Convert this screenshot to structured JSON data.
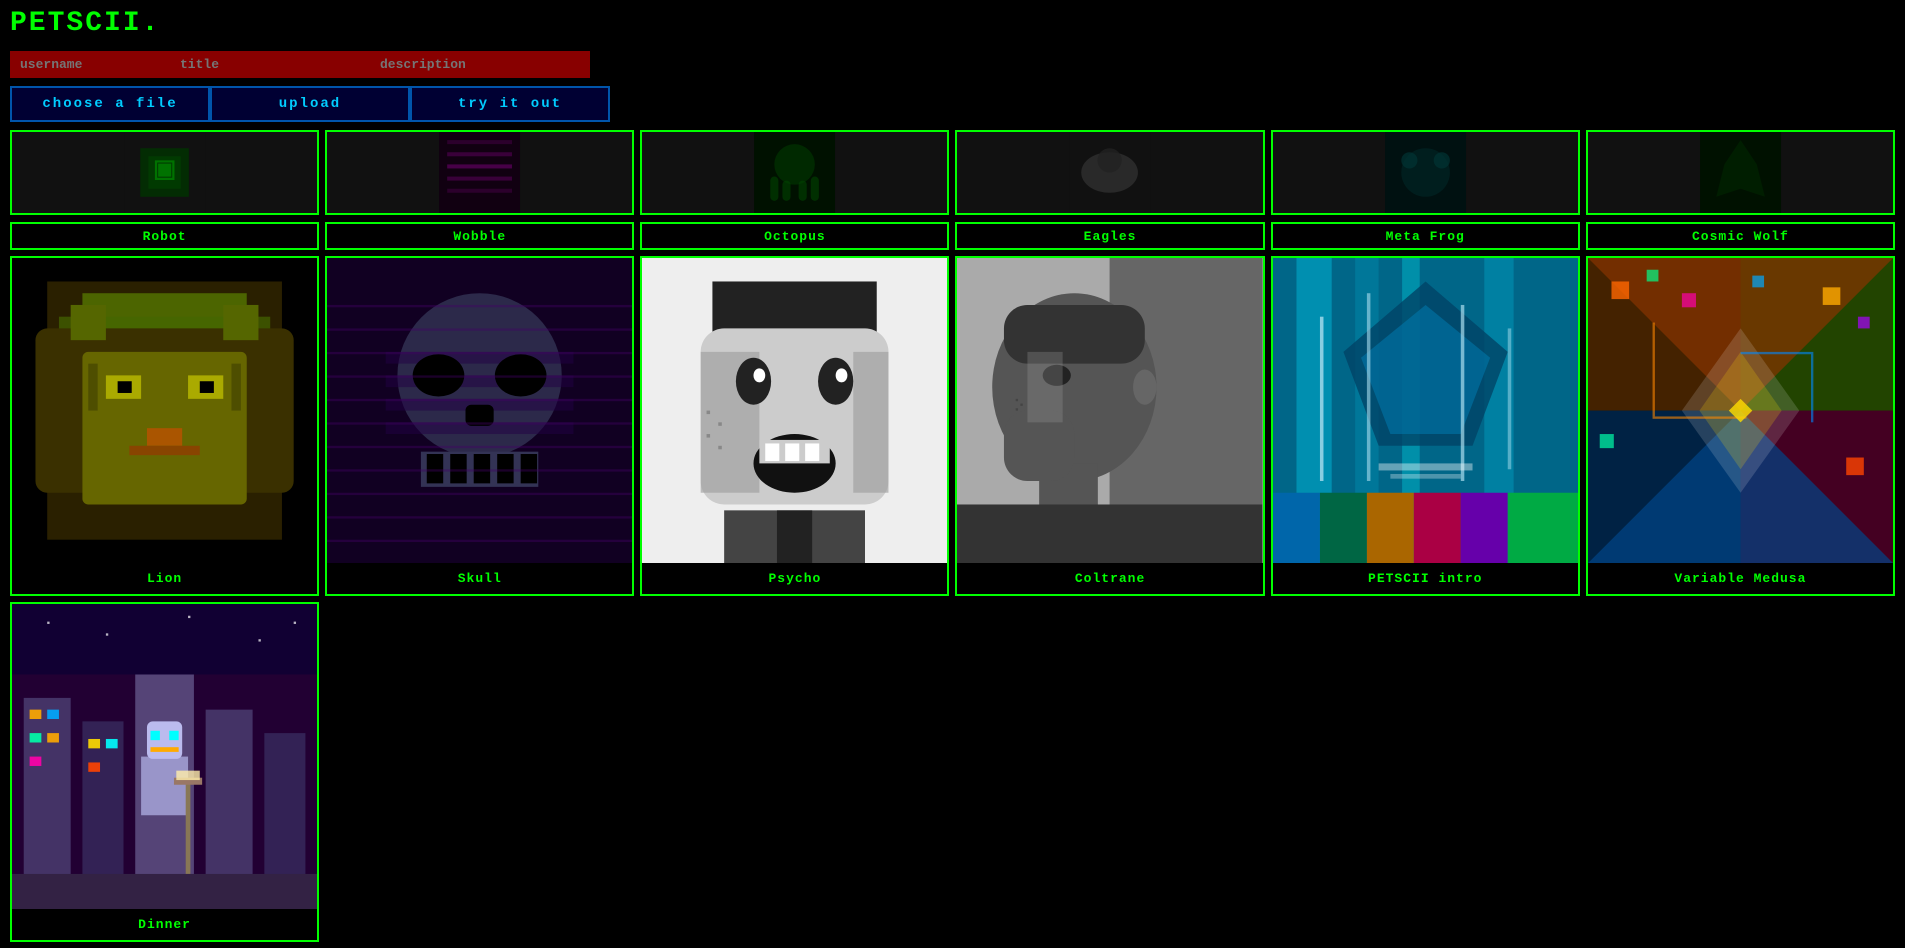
{
  "site": {
    "title": "PETSCII.",
    "accent_color": "#00ff00",
    "bg_color": "#000000"
  },
  "toolbar": {
    "username_placeholder": "username",
    "title_placeholder": "title",
    "description_placeholder": "description",
    "choose_label": "choose a file",
    "upload_label": "upload",
    "tryit_label": "try it out"
  },
  "gallery_top_row": [
    {
      "id": "robot",
      "label": "Robot",
      "thumb_type": "robot"
    },
    {
      "id": "wobble",
      "label": "Wobble",
      "thumb_type": "wobble"
    },
    {
      "id": "octopus",
      "label": "Octopus",
      "thumb_type": "octopus"
    },
    {
      "id": "eagles",
      "label": "Eagles",
      "thumb_type": "eagles"
    },
    {
      "id": "metafrog",
      "label": "Meta Frog",
      "thumb_type": "metafrog"
    },
    {
      "id": "cosmicwolf",
      "label": "Cosmic Wolf",
      "thumb_type": "cosmicwolf"
    }
  ],
  "gallery_mid_row": [
    {
      "id": "lion",
      "label": "Lion",
      "thumb_type": "lion"
    },
    {
      "id": "skull",
      "label": "Skull",
      "thumb_type": "skull"
    },
    {
      "id": "psycho",
      "label": "Psycho",
      "thumb_type": "psycho"
    },
    {
      "id": "coltrane",
      "label": "Coltrane",
      "thumb_type": "coltrane"
    },
    {
      "id": "petscii_intro",
      "label": "PETSCII intro",
      "thumb_type": "petscii"
    },
    {
      "id": "variable_medusa",
      "label": "Variable Medusa",
      "thumb_type": "variable"
    }
  ],
  "gallery_bottom_row": [
    {
      "id": "dinner",
      "label": "Dinner",
      "thumb_type": "dinner"
    }
  ]
}
